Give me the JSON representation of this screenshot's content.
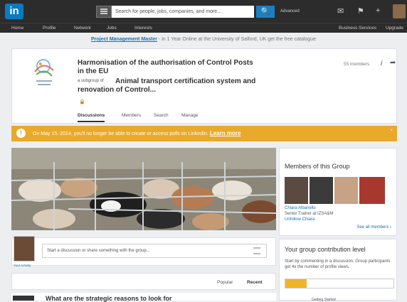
{
  "topbar": {
    "logo": "in",
    "search_placeholder": "Search for people, jobs, companies, and more...",
    "search_button": "🔍",
    "advanced": "Advanced"
  },
  "nav": {
    "items": [
      "Home",
      "Profile",
      "Network",
      "Jobs",
      "Interests"
    ],
    "right_items": [
      "Business Services",
      "Upgrade"
    ]
  },
  "promo": {
    "link": "Project Management Master",
    "text": " - in 1 Year Online at the University of Salford, UK get the free catalogue"
  },
  "group": {
    "title": "Harmonisation of the authorisation of Control Posts in the EU",
    "subgroup_label": "a subgroup of",
    "subgroup_title": "Animal transport certification system and renovation of Control...",
    "members": "55 members",
    "tabs": [
      "Discussions",
      "Members",
      "Search",
      "Manage"
    ]
  },
  "notice": {
    "text": "On May 15, 2014, you'll no longer be able to create or access polls on LinkedIn.",
    "link": "Learn more"
  },
  "composer": {
    "placeholder": "Start a discussion or share something with the group...",
    "your_activity": "Your Activity"
  },
  "sort": {
    "popular": "Popular",
    "recent": "Recent"
  },
  "next_post": {
    "title": "What are the strategic reasons to look for"
  },
  "members_card": {
    "title": "Members of this Group",
    "featured_name": "Chiara Albanello",
    "featured_role": "Senior Trainer at IZSA&M",
    "unfollow": "Unfollow Chiara",
    "see_all": "See all members ›"
  },
  "contribution": {
    "title": "Your group contribution level",
    "description": "Start by commenting in a discussion. Group participants get 4x the number of profile views.",
    "level": "Getting Started",
    "progress": 0.2,
    "bar_color": "#f0b429"
  },
  "colors": {
    "topbar": "#2c2c2c",
    "accent": "#1a7fc4",
    "notice": "#e9a92b"
  }
}
